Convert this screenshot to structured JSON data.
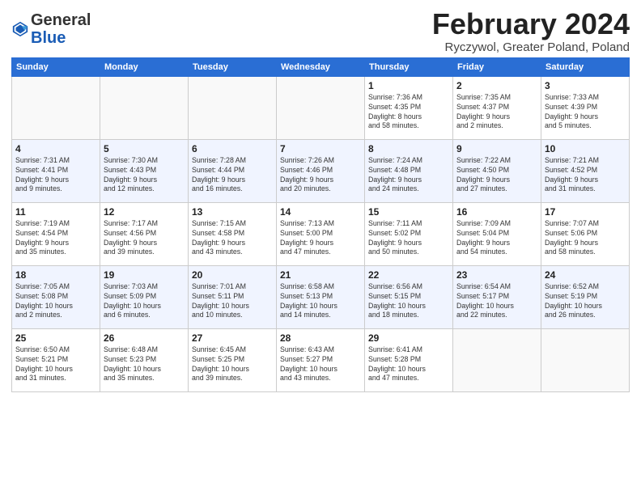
{
  "header": {
    "logo_general": "General",
    "logo_blue": "Blue",
    "month_title": "February 2024",
    "subtitle": "Ryczywol, Greater Poland, Poland"
  },
  "weekdays": [
    "Sunday",
    "Monday",
    "Tuesday",
    "Wednesday",
    "Thursday",
    "Friday",
    "Saturday"
  ],
  "weeks": [
    [
      {
        "day": "",
        "info": ""
      },
      {
        "day": "",
        "info": ""
      },
      {
        "day": "",
        "info": ""
      },
      {
        "day": "",
        "info": ""
      },
      {
        "day": "1",
        "info": "Sunrise: 7:36 AM\nSunset: 4:35 PM\nDaylight: 8 hours\nand 58 minutes."
      },
      {
        "day": "2",
        "info": "Sunrise: 7:35 AM\nSunset: 4:37 PM\nDaylight: 9 hours\nand 2 minutes."
      },
      {
        "day": "3",
        "info": "Sunrise: 7:33 AM\nSunset: 4:39 PM\nDaylight: 9 hours\nand 5 minutes."
      }
    ],
    [
      {
        "day": "4",
        "info": "Sunrise: 7:31 AM\nSunset: 4:41 PM\nDaylight: 9 hours\nand 9 minutes."
      },
      {
        "day": "5",
        "info": "Sunrise: 7:30 AM\nSunset: 4:43 PM\nDaylight: 9 hours\nand 12 minutes."
      },
      {
        "day": "6",
        "info": "Sunrise: 7:28 AM\nSunset: 4:44 PM\nDaylight: 9 hours\nand 16 minutes."
      },
      {
        "day": "7",
        "info": "Sunrise: 7:26 AM\nSunset: 4:46 PM\nDaylight: 9 hours\nand 20 minutes."
      },
      {
        "day": "8",
        "info": "Sunrise: 7:24 AM\nSunset: 4:48 PM\nDaylight: 9 hours\nand 24 minutes."
      },
      {
        "day": "9",
        "info": "Sunrise: 7:22 AM\nSunset: 4:50 PM\nDaylight: 9 hours\nand 27 minutes."
      },
      {
        "day": "10",
        "info": "Sunrise: 7:21 AM\nSunset: 4:52 PM\nDaylight: 9 hours\nand 31 minutes."
      }
    ],
    [
      {
        "day": "11",
        "info": "Sunrise: 7:19 AM\nSunset: 4:54 PM\nDaylight: 9 hours\nand 35 minutes."
      },
      {
        "day": "12",
        "info": "Sunrise: 7:17 AM\nSunset: 4:56 PM\nDaylight: 9 hours\nand 39 minutes."
      },
      {
        "day": "13",
        "info": "Sunrise: 7:15 AM\nSunset: 4:58 PM\nDaylight: 9 hours\nand 43 minutes."
      },
      {
        "day": "14",
        "info": "Sunrise: 7:13 AM\nSunset: 5:00 PM\nDaylight: 9 hours\nand 47 minutes."
      },
      {
        "day": "15",
        "info": "Sunrise: 7:11 AM\nSunset: 5:02 PM\nDaylight: 9 hours\nand 50 minutes."
      },
      {
        "day": "16",
        "info": "Sunrise: 7:09 AM\nSunset: 5:04 PM\nDaylight: 9 hours\nand 54 minutes."
      },
      {
        "day": "17",
        "info": "Sunrise: 7:07 AM\nSunset: 5:06 PM\nDaylight: 9 hours\nand 58 minutes."
      }
    ],
    [
      {
        "day": "18",
        "info": "Sunrise: 7:05 AM\nSunset: 5:08 PM\nDaylight: 10 hours\nand 2 minutes."
      },
      {
        "day": "19",
        "info": "Sunrise: 7:03 AM\nSunset: 5:09 PM\nDaylight: 10 hours\nand 6 minutes."
      },
      {
        "day": "20",
        "info": "Sunrise: 7:01 AM\nSunset: 5:11 PM\nDaylight: 10 hours\nand 10 minutes."
      },
      {
        "day": "21",
        "info": "Sunrise: 6:58 AM\nSunset: 5:13 PM\nDaylight: 10 hours\nand 14 minutes."
      },
      {
        "day": "22",
        "info": "Sunrise: 6:56 AM\nSunset: 5:15 PM\nDaylight: 10 hours\nand 18 minutes."
      },
      {
        "day": "23",
        "info": "Sunrise: 6:54 AM\nSunset: 5:17 PM\nDaylight: 10 hours\nand 22 minutes."
      },
      {
        "day": "24",
        "info": "Sunrise: 6:52 AM\nSunset: 5:19 PM\nDaylight: 10 hours\nand 26 minutes."
      }
    ],
    [
      {
        "day": "25",
        "info": "Sunrise: 6:50 AM\nSunset: 5:21 PM\nDaylight: 10 hours\nand 31 minutes."
      },
      {
        "day": "26",
        "info": "Sunrise: 6:48 AM\nSunset: 5:23 PM\nDaylight: 10 hours\nand 35 minutes."
      },
      {
        "day": "27",
        "info": "Sunrise: 6:45 AM\nSunset: 5:25 PM\nDaylight: 10 hours\nand 39 minutes."
      },
      {
        "day": "28",
        "info": "Sunrise: 6:43 AM\nSunset: 5:27 PM\nDaylight: 10 hours\nand 43 minutes."
      },
      {
        "day": "29",
        "info": "Sunrise: 6:41 AM\nSunset: 5:28 PM\nDaylight: 10 hours\nand 47 minutes."
      },
      {
        "day": "",
        "info": ""
      },
      {
        "day": "",
        "info": ""
      }
    ]
  ]
}
